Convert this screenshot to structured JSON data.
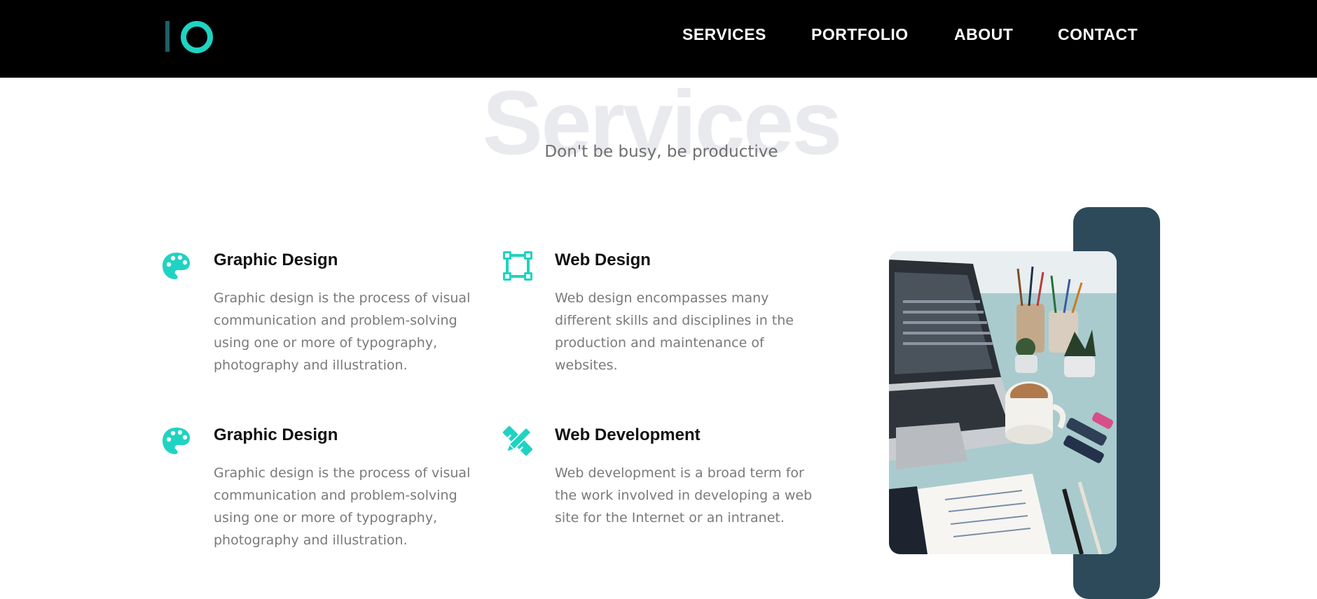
{
  "nav": {
    "logo_alt": "IO",
    "links": [
      "SERVICES",
      "PORTFOLIO",
      "ABOUT",
      "CONTACT"
    ]
  },
  "section": {
    "bg_title": "Services",
    "subtitle": "Don't be busy, be productive"
  },
  "services": [
    {
      "icon": "palette-icon",
      "title": "Graphic Design",
      "text": "Graphic design is the process of visual communication and problem-solving using one or more of typography, photography and illustration."
    },
    {
      "icon": "vector-square-icon",
      "title": "Web Design",
      "text": "Web design encompasses many different skills and disciplines in the production and maintenance of websites."
    },
    {
      "icon": "palette-icon",
      "title": "Graphic Design",
      "text": "Graphic design is the process of visual communication and problem-solving using one or more of typography, photography and illustration."
    },
    {
      "icon": "pencil-ruler-icon",
      "title": "Web Development",
      "text": "Web development is a broad term for the work involved in developing a web site for the Internet or an intranet."
    }
  ],
  "colors": {
    "accent": "#1fd3c2",
    "navbar": "#000000",
    "panel": "#2d4a5a",
    "bg_title": "#e9eaee"
  }
}
